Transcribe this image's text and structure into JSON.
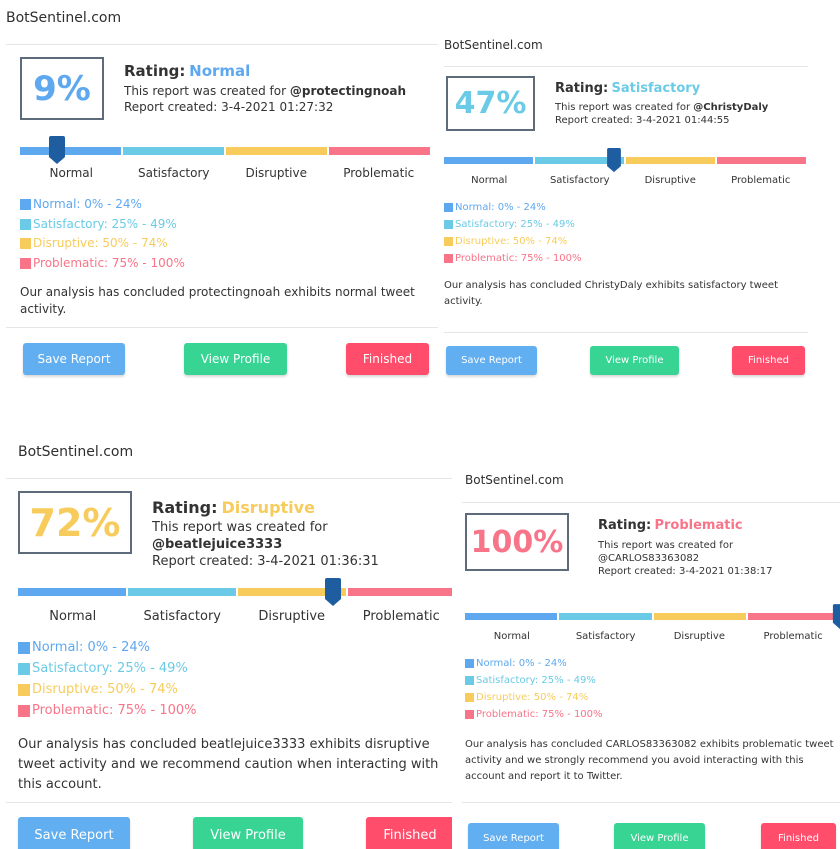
{
  "colors": {
    "normal": "#5ea8ef",
    "satisfactory": "#6bcbe6",
    "disruptive": "#f7cc5c",
    "problematic": "#f87488",
    "marker": "#1e5ea0",
    "save_button": "#61aef0",
    "view_button": "#38d494",
    "finished_button": "#ff4d6b"
  },
  "reports": [
    {
      "site": "BotSentinel.com",
      "percent": "9%",
      "score": 0.09,
      "rating_label": "Rating:",
      "rating": "Normal",
      "created_for": "This report was created for",
      "handle": "@protectingnoah",
      "created": "Report created: 3-4-2021 01:27:32",
      "categories": [
        "Normal",
        "Satisfactory",
        "Disruptive",
        "Problematic"
      ],
      "legend": [
        "Normal: 0% - 24%",
        "Satisfactory: 25% - 49%",
        "Disruptive: 50% - 74%",
        "Problematic: 75% - 100%"
      ],
      "summary": "Our analysis has concluded protectingnoah exhibits normal tweet activity.",
      "buttons": {
        "save": "Save Report",
        "view": "View Profile",
        "finished": "Finished"
      }
    },
    {
      "site": "BotSentinel.com",
      "percent": "47%",
      "score": 0.47,
      "rating_label": "Rating:",
      "rating": "Satisfactory",
      "created_for": "This report was created for",
      "handle": "@ChristyDaly",
      "created": "Report created: 3-4-2021 01:44:55",
      "categories": [
        "Normal",
        "Satisfactory",
        "Disruptive",
        "Problematic"
      ],
      "legend": [
        "Normal: 0% - 24%",
        "Satisfactory: 25% - 49%",
        "Disruptive: 50% - 74%",
        "Problematic: 75% - 100%"
      ],
      "summary": "Our analysis has concluded ChristyDaly exhibits satisfactory tweet activity.",
      "buttons": {
        "save": "Save Report",
        "view": "View Profile",
        "finished": "Finished"
      }
    },
    {
      "site": "BotSentinel.com",
      "percent": "72%",
      "score": 0.72,
      "rating_label": "Rating:",
      "rating": "Disruptive",
      "created_for": "This report was created for",
      "handle": "@beatlejuice3333",
      "created": "Report created: 3-4-2021 01:36:31",
      "categories": [
        "Normal",
        "Satisfactory",
        "Disruptive",
        "Problematic"
      ],
      "legend": [
        "Normal: 0% - 24%",
        "Satisfactory: 25% - 49%",
        "Disruptive: 50% - 74%",
        "Problematic: 75% - 100%"
      ],
      "summary": "Our analysis has concluded beatlejuice3333 exhibits disruptive tweet activity and we recommend caution when interacting with this account.",
      "buttons": {
        "save": "Save Report",
        "view": "View Profile",
        "finished": "Finished"
      }
    },
    {
      "site": "BotSentinel.com",
      "percent": "100%",
      "score": 1.0,
      "rating_label": "Rating:",
      "rating": "Problematic",
      "created_for": "This report was created for",
      "handle": "@CARLOS83363082",
      "created": "Report created: 3-4-2021 01:38:17",
      "categories": [
        "Normal",
        "Satisfactory",
        "Disruptive",
        "Problematic"
      ],
      "legend": [
        "Normal: 0% - 24%",
        "Satisfactory: 25% - 49%",
        "Disruptive: 50% - 74%",
        "Problematic: 75% - 100%"
      ],
      "summary": "Our analysis has concluded CARLOS83363082 exhibits problematic tweet activity and we strongly recommend you avoid interacting with this account and report it to Twitter.",
      "buttons": {
        "save": "Save Report",
        "view": "View Profile",
        "finished": "Finished"
      }
    }
  ]
}
